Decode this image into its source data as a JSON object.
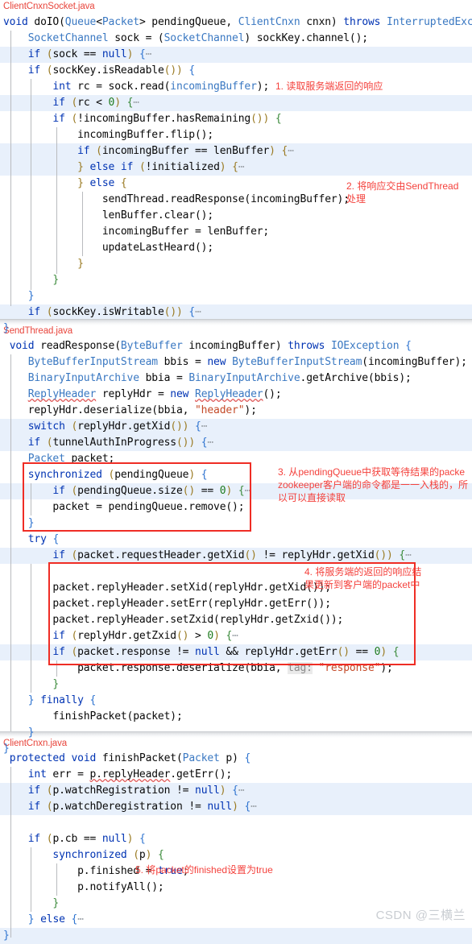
{
  "meta": {
    "watermark": "CSDN @三横兰",
    "accent_red": "#f4413c",
    "box_red": "#ef2d25",
    "highlight_blue": "#e8f0fb",
    "keyword_blue": "#0033b3",
    "type_blue": "#3a78c2",
    "string_orange": "#c44a28"
  },
  "sections": [
    {
      "file": "ClientCnxnSocket.java",
      "lines": [
        "void doIO(Queue<Packet> pendingQueue, ClientCnxn cnxn) throws InterruptedExc",
        "    SocketChannel sock = (SocketChannel) sockKey.channel();",
        "    if (sock == null) {…",
        "    if (sockKey.isReadable()) {",
        "        int rc = sock.read(incomingBuffer);",
        "        if (rc < 0) {…",
        "        if (!incomingBuffer.hasRemaining()) {",
        "            incomingBuffer.flip();",
        "            if (incomingBuffer == lenBuffer) {…",
        "            } else if (!initialized) {…",
        "            } else {",
        "                sendThread.readResponse(incomingBuffer);",
        "                lenBuffer.clear();",
        "                incomingBuffer = lenBuffer;",
        "                updateLastHeard();",
        "            }",
        "        }",
        "    }",
        "    if (sockKey.isWritable()) {…",
        "}"
      ]
    },
    {
      "file": "SendThread.java",
      "lines": [
        " void readResponse(ByteBuffer incomingBuffer) throws IOException {",
        "    ByteBufferInputStream bbis = new ByteBufferInputStream(incomingBuffer);",
        "    BinaryInputArchive bbia = BinaryInputArchive.getArchive(bbis);",
        "    ReplyHeader replyHdr = new ReplyHeader();",
        "    replyHdr.deserialize(bbia, \"header\");",
        "    switch (replyHdr.getXid()) {…",
        "    if (tunnelAuthInProgress()) {…",
        "    Packet packet;",
        "    synchronized (pendingQueue) {",
        "        if (pendingQueue.size() == 0) {…",
        "        packet = pendingQueue.remove();",
        "    }",
        "    try {",
        "        if (packet.requestHeader.getXid() != replyHdr.getXid()) {…",
        "",
        "        packet.replyHeader.setXid(replyHdr.getXid());",
        "        packet.replyHeader.setErr(replyHdr.getErr());",
        "        packet.replyHeader.setZxid(replyHdr.getZxid());",
        "        if (replyHdr.getZxid() > 0) {…",
        "        if (packet.response != null && replyHdr.getErr() == 0) {",
        "            packet.response.deserialize(bbia, tag: \"response\");",
        "        }",
        "    } finally {",
        "        finishPacket(packet);",
        "    }",
        "}"
      ]
    },
    {
      "file": "ClientCnxn.java",
      "lines": [
        " protected void finishPacket(Packet p) {",
        "    int err = p.replyHeader.getErr();",
        "    if (p.watchRegistration != null) {…",
        "    if (p.watchDeregistration != null) {…",
        "",
        "    if (p.cb == null) {",
        "        synchronized (p) {",
        "            p.finished = true;",
        "            p.notifyAll();",
        "        }",
        "    } else {…",
        "}"
      ]
    }
  ],
  "annotations": [
    {
      "id": "annot-1",
      "text": "1. 读取服务端返回的响应"
    },
    {
      "id": "annot-2",
      "text": "2. 将响应交由SendThread\n处理"
    },
    {
      "id": "annot-3",
      "text": "3. 从pendingQueue中获取等待结果的packe\nzookeeper客户端的命令都是一一入栈的，所\n以可以直接读取"
    },
    {
      "id": "annot-4",
      "text": "4. 将服务端的返回的响应结\n果更新到客户端的packet中"
    },
    {
      "id": "annot-5",
      "text": "5. 将packet的finished设置为true"
    }
  ]
}
